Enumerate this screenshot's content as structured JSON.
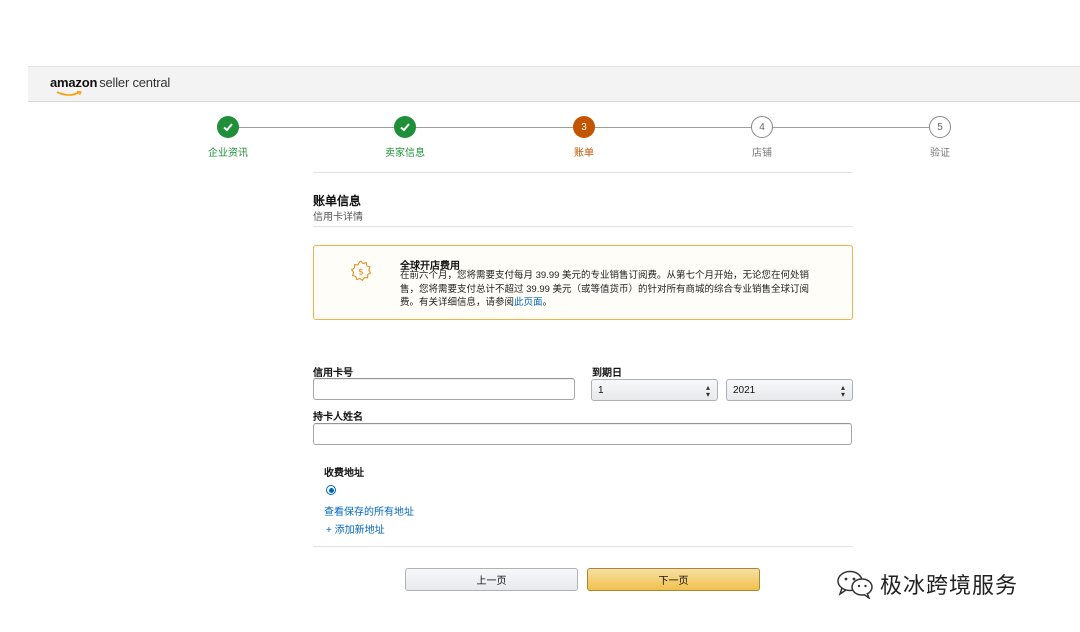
{
  "header": {
    "logo_brand": "amazon",
    "logo_product": "seller central"
  },
  "stepper": {
    "steps": [
      {
        "label": "企业资讯",
        "number": "1",
        "state": "done"
      },
      {
        "label": "卖家信息",
        "number": "2",
        "state": "done"
      },
      {
        "label": "账单",
        "number": "3",
        "state": "current"
      },
      {
        "label": "店铺",
        "number": "4",
        "state": "todo"
      },
      {
        "label": "验证",
        "number": "5",
        "state": "todo"
      }
    ]
  },
  "billing": {
    "title": "账单信息",
    "subtitle": "信用卡详情"
  },
  "notice": {
    "title": "全球开店费用",
    "body": "在前六个月，您将需要支付每月 39.99 美元的专业销售订阅费。从第七个月开始，无论您在何处销售，您将需要支付总计不超过 39.99 美元（或等值货币）的针对所有商城的综合专业销售全球订阅费。有关详细信息，请参阅",
    "link_text": "此页面",
    "body_end": "。"
  },
  "form": {
    "card_number_label": "信用卡号",
    "card_number_value": "",
    "expiry_label": "到期日",
    "expiry_month": "1",
    "expiry_year": "2021",
    "cardholder_label": "持卡人姓名",
    "cardholder_value": "",
    "billing_address_label": "收费地址",
    "view_saved_addresses": "查看保存的所有地址",
    "add_new_address": "+ 添加新地址"
  },
  "buttons": {
    "prev": "上一页",
    "next": "下一页"
  },
  "watermark": {
    "text": "极冰跨境服务",
    "icon": "wechat-icon"
  },
  "colors": {
    "done": "#1f8f3a",
    "current": "#c45500",
    "link": "#0066c0",
    "notice_border": "#f0b24b",
    "primary_button": "#f0c14b"
  }
}
